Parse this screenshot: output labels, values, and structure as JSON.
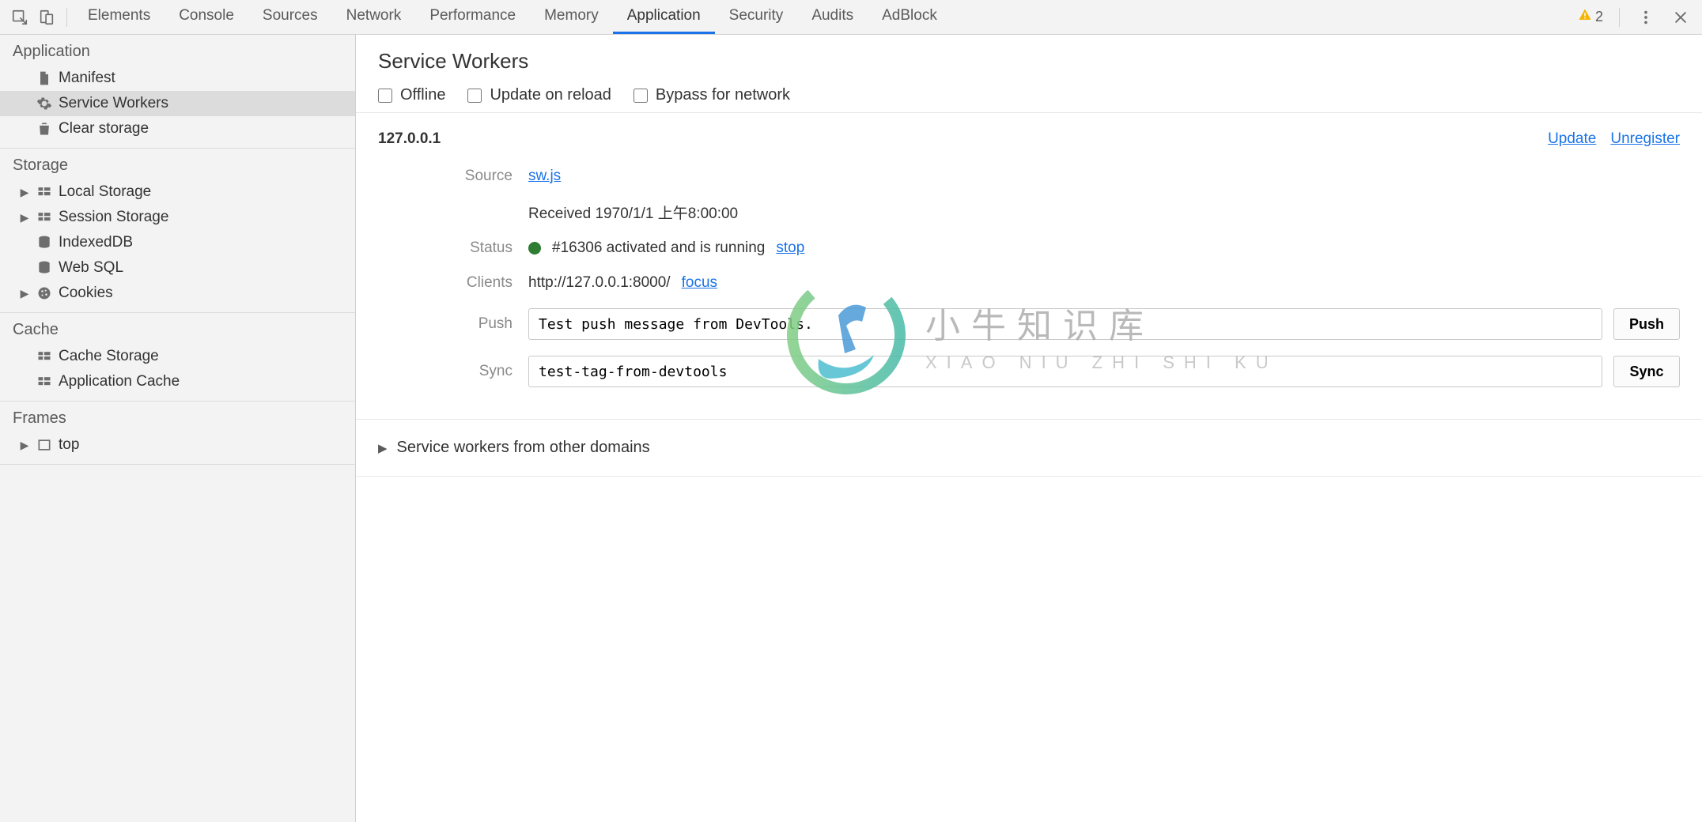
{
  "top": {
    "tabs": [
      "Elements",
      "Console",
      "Sources",
      "Network",
      "Performance",
      "Memory",
      "Application",
      "Security",
      "Audits",
      "AdBlock"
    ],
    "active_index": 6,
    "warning_count": "2"
  },
  "sidebar": {
    "sections": [
      {
        "title": "Application",
        "items": [
          {
            "label": "Manifest",
            "icon": "file-icon",
            "expandable": false
          },
          {
            "label": "Service Workers",
            "icon": "gear-icon",
            "expandable": false,
            "selected": true
          },
          {
            "label": "Clear storage",
            "icon": "trash-icon",
            "expandable": false
          }
        ]
      },
      {
        "title": "Storage",
        "items": [
          {
            "label": "Local Storage",
            "icon": "grid-icon",
            "expandable": true
          },
          {
            "label": "Session Storage",
            "icon": "grid-icon",
            "expandable": true
          },
          {
            "label": "IndexedDB",
            "icon": "db-icon",
            "expandable": false
          },
          {
            "label": "Web SQL",
            "icon": "db-icon",
            "expandable": false
          },
          {
            "label": "Cookies",
            "icon": "cookie-icon",
            "expandable": true
          }
        ]
      },
      {
        "title": "Cache",
        "items": [
          {
            "label": "Cache Storage",
            "icon": "grid-icon",
            "expandable": false
          },
          {
            "label": "Application Cache",
            "icon": "grid-icon",
            "expandable": false
          }
        ]
      },
      {
        "title": "Frames",
        "items": [
          {
            "label": "top",
            "icon": "frame-icon",
            "expandable": true
          }
        ]
      }
    ]
  },
  "content": {
    "title": "Service Workers",
    "checkboxes": {
      "offline": "Offline",
      "update_on_reload": "Update on reload",
      "bypass_for_network": "Bypass for network"
    },
    "scope": "127.0.0.1",
    "actions": {
      "update": "Update",
      "unregister": "Unregister"
    },
    "details": {
      "source_label": "Source",
      "source_link": "sw.js",
      "received_label": "Received",
      "received_value": "Received 1970/1/1 上午8:00:00",
      "status_label": "Status",
      "status_text": "#16306 activated and is running",
      "status_stop": "stop",
      "clients_label": "Clients",
      "clients_url": "http://127.0.0.1:8000/",
      "clients_focus": "focus",
      "push_label": "Push",
      "push_value": "Test push message from DevTools.",
      "push_button": "Push",
      "sync_label": "Sync",
      "sync_value": "test-tag-from-devtools",
      "sync_button": "Sync"
    },
    "other_domains": "Service workers from other domains"
  },
  "watermark": {
    "cn": "小牛知识库",
    "en": "XIAO NIU ZHI SHI KU"
  }
}
